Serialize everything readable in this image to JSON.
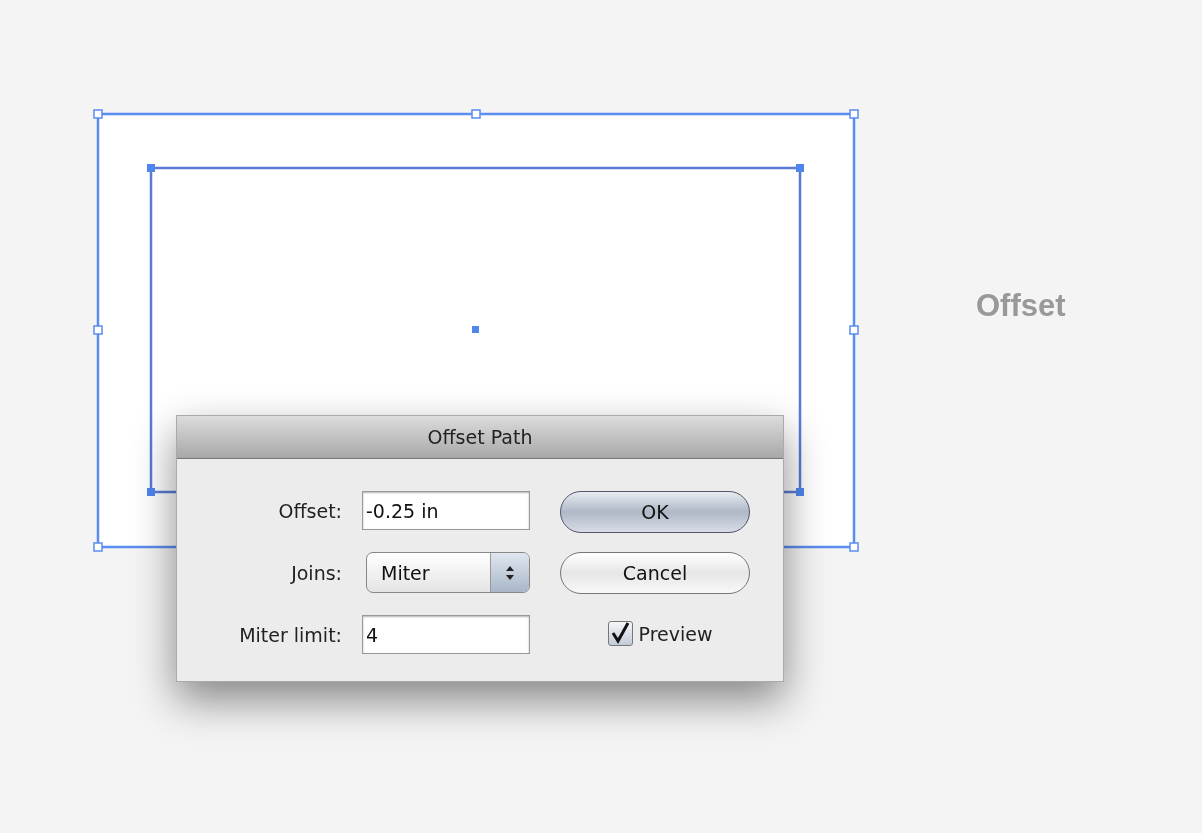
{
  "caption": "Offset",
  "dialog": {
    "title": "Offset Path",
    "fields": [
      {
        "kind": "text",
        "label": "Offset:",
        "value": "-0.25 in"
      },
      {
        "kind": "select",
        "label": "Joins:",
        "value": "Miter"
      },
      {
        "kind": "text",
        "label": "Miter limit:",
        "value": "4"
      }
    ],
    "buttons": [
      {
        "label": "OK",
        "default": true
      },
      {
        "label": "Cancel",
        "default": false
      }
    ],
    "preview": {
      "label": "Preview",
      "checked": true
    }
  }
}
